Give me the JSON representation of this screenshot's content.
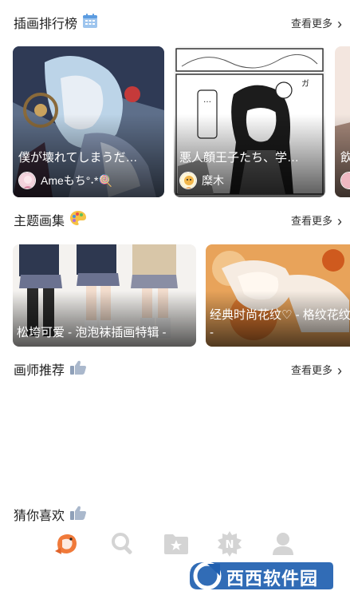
{
  "ranking": {
    "title": "插画排行榜",
    "more": "查看更多",
    "cards": [
      {
        "title": "僕が壊れてしまうだ…",
        "author": "Ameもち°˖*🍭"
      },
      {
        "title": "悪人顔王子たち、学…",
        "author": "糜木"
      },
      {
        "title": "飲"
      }
    ]
  },
  "albums": {
    "title": "主题画集",
    "more": "查看更多",
    "cards": [
      {
        "title": "松垮可爱 - 泡泡袜插画特辑 -"
      },
      {
        "title": "经典时尚花纹♡ - 格纹花纹 - 特辑 -"
      }
    ]
  },
  "artists": {
    "title": "画师推荐",
    "more": "查看更多"
  },
  "guess": {
    "title": "猜你喜欢"
  },
  "watermark": {
    "text": "西西软件园"
  },
  "colors": {
    "accent_orange": "#f07a3a",
    "tab_gray": "#d4d4d4"
  }
}
